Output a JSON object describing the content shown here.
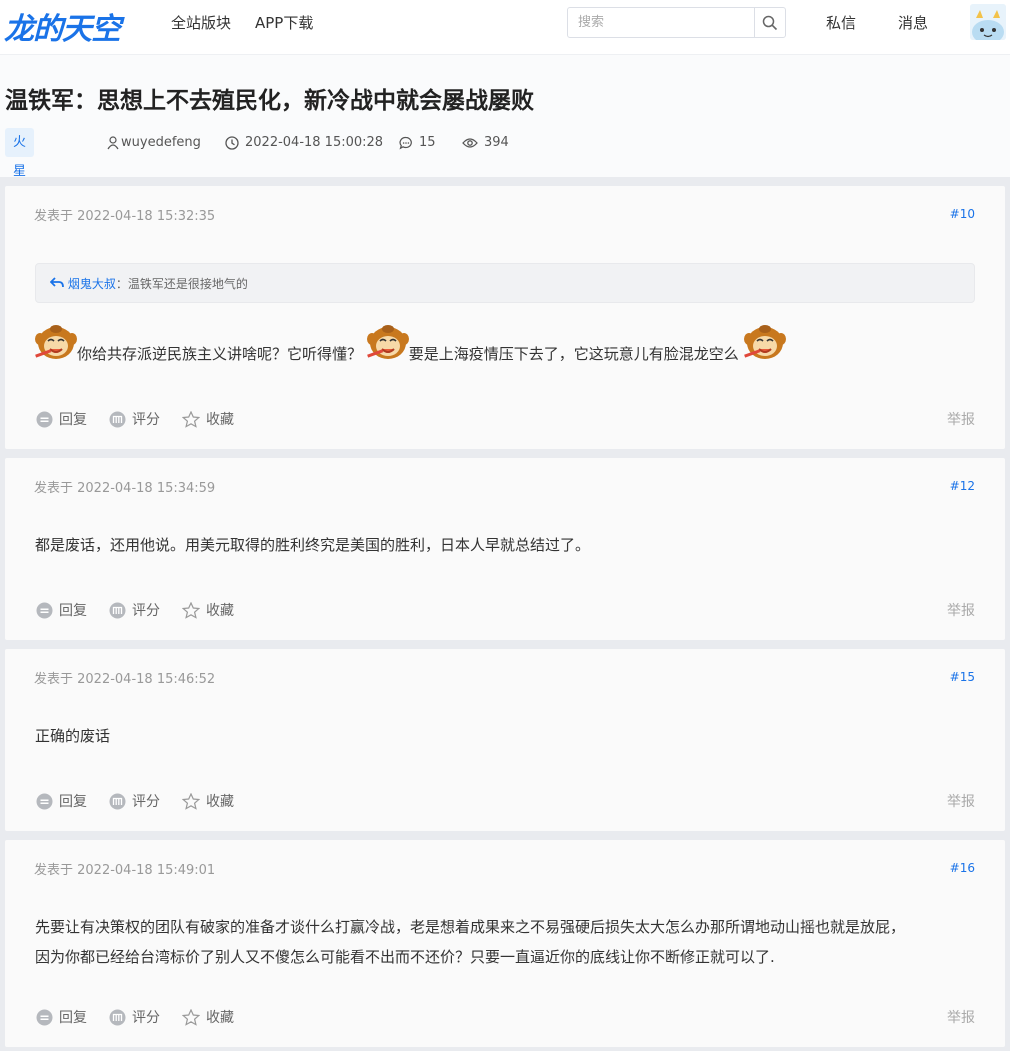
{
  "header": {
    "logo": "龙的天空",
    "nav": [
      "全站版块",
      "APP下载"
    ],
    "search_placeholder": "搜索",
    "messages": "私信",
    "notifications": "消息"
  },
  "thread": {
    "title": "温铁军：思想上不去殖民化，新冷战中就会屡战屡败",
    "board": "火星社会",
    "author": "wuyedefeng",
    "datetime": "2022-04-18 15:00:28",
    "replies": "15",
    "views": "394"
  },
  "labels": {
    "reply": "回复",
    "rate": "评分",
    "favorite": "收藏",
    "report": "举报"
  },
  "posts": [
    {
      "time": "发表于 2022-04-18 15:32:35",
      "floor": "#10",
      "quote_user": "烟鬼大叔",
      "quote_sep": "：",
      "quote_text": "温铁军还是很接地气的",
      "parts": [
        "你给共存派逆民族主义讲啥呢？它听得懂？",
        "要是上海疫情压下去了，它这玩意儿有脸混龙空么"
      ]
    },
    {
      "time": "发表于 2022-04-18 15:34:59",
      "floor": "#12",
      "text": "都是废话，还用他说。用美元取得的胜利终究是美国的胜利，日本人早就总结过了。"
    },
    {
      "time": "发表于 2022-04-18 15:46:52",
      "floor": "#15",
      "text": "正确的废话"
    },
    {
      "time": "发表于 2022-04-18 15:49:01",
      "floor": "#16",
      "line1": "先要让有决策权的团队有破家的准备才谈什么打赢冷战，老是想着成果来之不易强硬后损失太大怎么办那所谓地动山摇也就是放屁，",
      "line2": "因为你都已经给台湾标价了别人又不傻怎么可能看不出而不还价？只要一直逼近你的底线让你不断修正就可以了."
    }
  ]
}
